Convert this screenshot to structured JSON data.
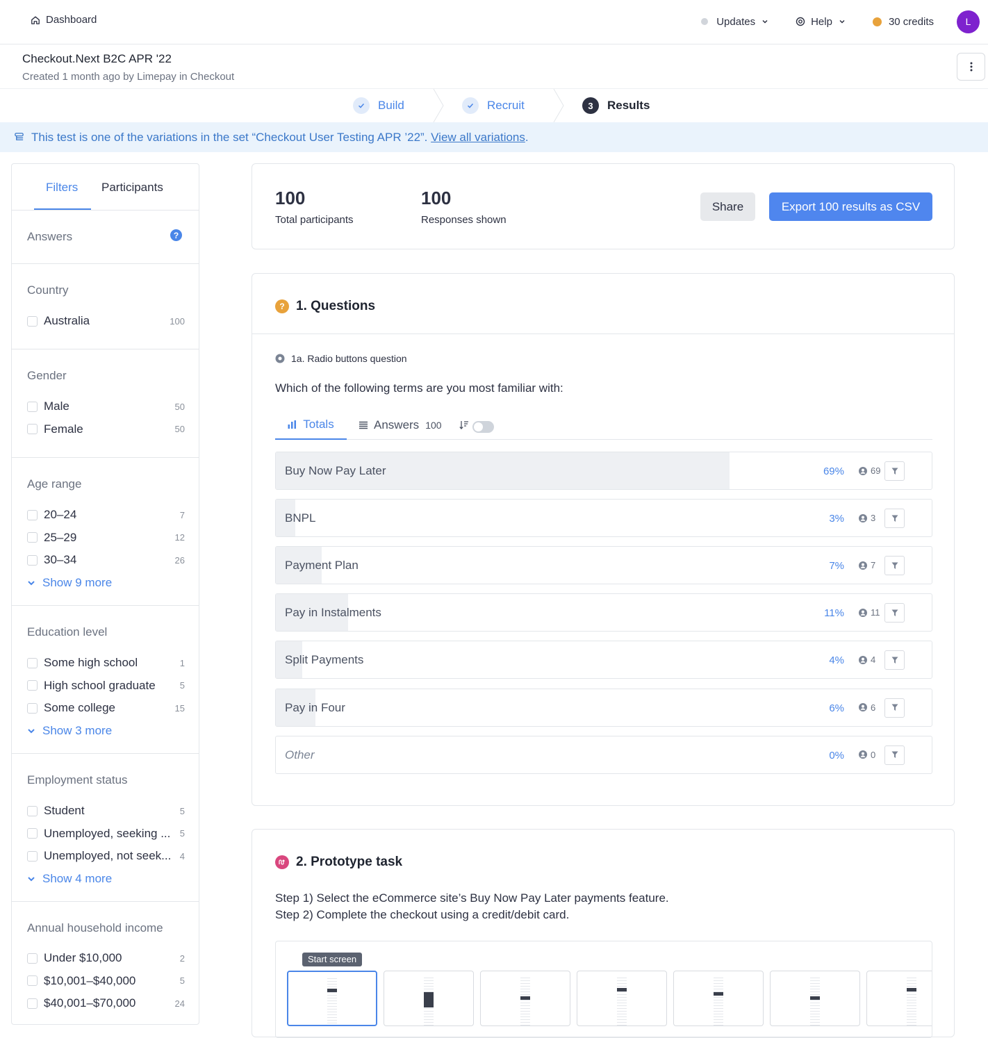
{
  "nav": {
    "dashboard": "Dashboard",
    "updates": "Updates",
    "help": "Help",
    "credits": "30 credits",
    "avatar_initial": "L"
  },
  "header": {
    "title": "Checkout.Next B2C APR '22",
    "subtitle": "Created 1 month ago by Limepay in Checkout"
  },
  "stepper": {
    "steps": [
      {
        "label": "Build",
        "state": "done"
      },
      {
        "label": "Recruit",
        "state": "done"
      },
      {
        "label": "Results",
        "number": "3",
        "state": "current"
      }
    ]
  },
  "banner": {
    "text": "This test is one of the variations in the set “Checkout User Testing APR ’22”. ",
    "link": "View all variations",
    "end": "."
  },
  "sidebar": {
    "tabs": [
      "Filters",
      "Participants"
    ],
    "answers_title": "Answers",
    "sections": [
      {
        "title": "Country",
        "items": [
          {
            "label": "Australia",
            "count": "100"
          }
        ]
      },
      {
        "title": "Gender",
        "items": [
          {
            "label": "Male",
            "count": "50"
          },
          {
            "label": "Female",
            "count": "50"
          }
        ]
      },
      {
        "title": "Age range",
        "items": [
          {
            "label": "20–24",
            "count": "7"
          },
          {
            "label": "25–29",
            "count": "12"
          },
          {
            "label": "30–34",
            "count": "26"
          }
        ],
        "more": "Show 9 more"
      },
      {
        "title": "Education level",
        "items": [
          {
            "label": "Some high school",
            "count": "1"
          },
          {
            "label": "High school graduate",
            "count": "5"
          },
          {
            "label": "Some college",
            "count": "15"
          }
        ],
        "more": "Show 3 more"
      },
      {
        "title": "Employment status",
        "items": [
          {
            "label": "Student",
            "count": "5"
          },
          {
            "label": "Unemployed, seeking ...",
            "count": "5"
          },
          {
            "label": "Unemployed, not seek...",
            "count": "4"
          }
        ],
        "more": "Show 4 more"
      },
      {
        "title": "Annual household income",
        "items": [
          {
            "label": "Under $10,000",
            "count": "2"
          },
          {
            "label": "$10,001–$40,000",
            "count": "5"
          },
          {
            "label": "$40,001–$70,000",
            "count": "24"
          }
        ]
      }
    ]
  },
  "summary": {
    "total_num": "100",
    "total_label": "Total participants",
    "shown_num": "100",
    "shown_label": "Responses shown",
    "share": "Share",
    "export": "Export 100 results as CSV"
  },
  "questions": {
    "heading": "1. Questions",
    "sub_label": "1a. Radio buttons question",
    "question": "Which of the following terms are you most familiar with:",
    "tab_totals": "Totals",
    "tab_answers": "Answers",
    "tab_answers_count": "100",
    "answers": [
      {
        "label": "Buy Now Pay Later",
        "pct": "69%",
        "count": "69",
        "fraction": 0.69
      },
      {
        "label": "BNPL",
        "pct": "3%",
        "count": "3",
        "fraction": 0.03
      },
      {
        "label": "Payment Plan",
        "pct": "7%",
        "count": "7",
        "fraction": 0.07
      },
      {
        "label": "Pay in Instalments",
        "pct": "11%",
        "count": "11",
        "fraction": 0.11
      },
      {
        "label": "Split Payments",
        "pct": "4%",
        "count": "4",
        "fraction": 0.04
      },
      {
        "label": "Pay in Four",
        "pct": "6%",
        "count": "6",
        "fraction": 0.06
      },
      {
        "label": "Other",
        "pct": "0%",
        "count": "0",
        "fraction": 0.0,
        "italic": true
      }
    ]
  },
  "prototype": {
    "heading": "2. Prototype task",
    "step1": "Step 1) Select the eCommerce site’s Buy Now Pay Later payments feature.",
    "step2": "Step 2) Complete the checkout using a credit/debit card.",
    "start_tag": "Start screen"
  },
  "colors": {
    "accent": "#4a86e8",
    "avatar": "#7e22ce",
    "credits_dot": "#e8a23b",
    "questions_icon": "#e8a23b",
    "prototype_icon": "#d9477e"
  }
}
